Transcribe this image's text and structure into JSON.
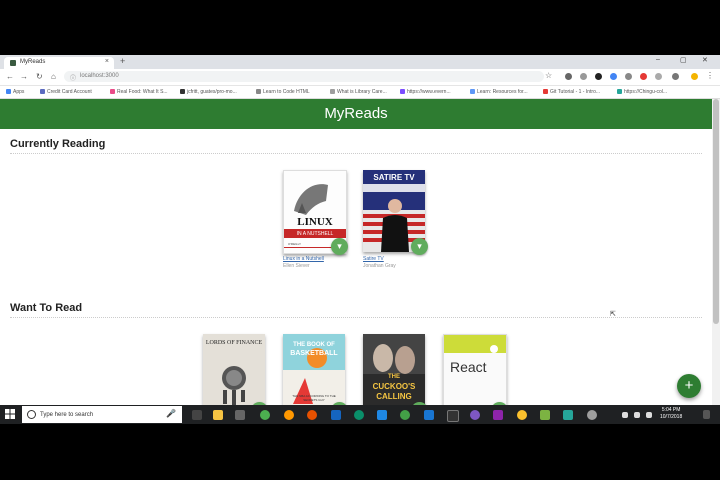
{
  "browser": {
    "tab_title": "MyReads",
    "tab_close": "×",
    "new_tab": "+",
    "url": "localhost:3000",
    "window_controls": [
      "–",
      "▢",
      "✕"
    ],
    "nav": {
      "back": "←",
      "forward": "→",
      "reload": "↻",
      "home": "⌂"
    }
  },
  "bookmarks": [
    {
      "label": "Apps",
      "color": "#4285f4"
    },
    {
      "label": "Credit Card Account",
      "color": "#5c6bc0"
    },
    {
      "label": "Real Food: What It S...",
      "color": "#ea4c89"
    },
    {
      "label": "jcfritt, guates/pro-mo...",
      "color": "#333333"
    },
    {
      "label": "Learn to Code HTML",
      "color": "#888888"
    },
    {
      "label": "What is Library Care...",
      "color": "#9e9e9e"
    },
    {
      "label": "https://www.evern...",
      "color": "#7c4dff"
    },
    {
      "label": "Learn: Resources for...",
      "color": "#5e97f6"
    },
    {
      "label": "Git Tutorial - 1 - Intro...",
      "color": "#e53935"
    },
    {
      "label": "https://Chingu-col...",
      "color": "#26a69a"
    }
  ],
  "app": {
    "title": "MyReads",
    "add_button": "+",
    "shelves": [
      {
        "title": "Currently Reading",
        "books": [
          {
            "title": "Linux in a Nutshell",
            "author": "Ellen Siever",
            "button": "▾",
            "cover": "linux"
          },
          {
            "title": "Satire TV",
            "author": "Jonathan Gray",
            "button": "▾",
            "cover": "satire"
          }
        ]
      },
      {
        "title": "Want To Read",
        "books": [
          {
            "title": "",
            "author": "",
            "button": "▾",
            "cover": "lords"
          },
          {
            "title": "",
            "author": "",
            "button": "▾",
            "cover": "basketball"
          },
          {
            "title": "",
            "author": "",
            "button": "▾",
            "cover": "cuckoo"
          },
          {
            "title": "",
            "author": "",
            "button": "▾",
            "cover": "react"
          }
        ]
      }
    ]
  },
  "covers": {
    "linux": {
      "line1": "LINUX",
      "line2": "IN A NUTSHELL",
      "publisher": "O'REILLY"
    },
    "satire": {
      "line1": "SATIRE TV"
    },
    "lords": {
      "line1": "LORDS OF FINANCE"
    },
    "basketball": {
      "line1": "THE BOOK OF",
      "line2": "BASKETBALL",
      "line3": "THE NBA ACCORDING TO THE SECRETS GUY"
    },
    "cuckoo": {
      "line1": "THE",
      "line2": "CUCKOO'S",
      "line3": "CALLING"
    },
    "react": {
      "line1": "React"
    }
  },
  "taskbar": {
    "search_placeholder": "Type here to search",
    "time": "5:04 PM",
    "date": "10/7/2018"
  }
}
